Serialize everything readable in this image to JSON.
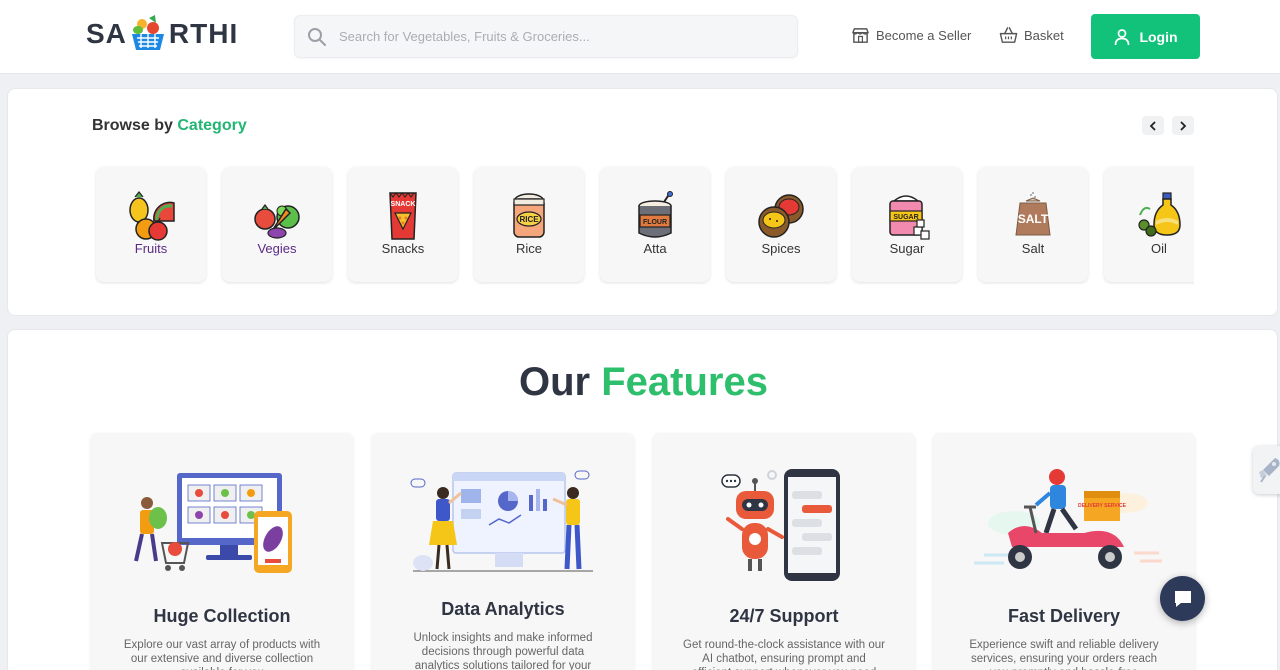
{
  "header": {
    "logo_left": "SA",
    "logo_right": "RTHI",
    "search_placeholder": "Search for Vegetables, Fruits & Groceries...",
    "become_seller": "Become a Seller",
    "basket": "Basket",
    "login": "Login",
    "accent_color": "#13c27a"
  },
  "categories": {
    "title_prefix": "Browse by",
    "title_accent": "Category",
    "items": [
      {
        "label": "Fruits",
        "icon": "fruits-icon"
      },
      {
        "label": "Vegies",
        "icon": "vegetables-icon"
      },
      {
        "label": "Snacks",
        "icon": "snacks-icon"
      },
      {
        "label": "Rice",
        "icon": "rice-icon"
      },
      {
        "label": "Atta",
        "icon": "flour-icon"
      },
      {
        "label": "Spices",
        "icon": "spices-icon"
      },
      {
        "label": "Sugar",
        "icon": "sugar-icon"
      },
      {
        "label": "Salt",
        "icon": "salt-icon"
      },
      {
        "label": "Oil",
        "icon": "oil-icon"
      }
    ],
    "tile_labels": {
      "snack_pack": "SNACK",
      "rice_jar": "RICE",
      "flour_jar": "FLOUR",
      "sugar_jar": "SUGAR",
      "salt_bag": "SALT"
    }
  },
  "features": {
    "heading_prefix": "Our",
    "heading_accent": "Features",
    "items": [
      {
        "title": "Huge Collection",
        "desc": "Explore our vast array of products with our extensive and diverse collection available for you"
      },
      {
        "title": "Data Analytics",
        "desc": "Unlock insights and make informed decisions through powerful data analytics solutions tailored for your"
      },
      {
        "title": "24/7 Support",
        "desc": "Get round-the-clock assistance with our AI chatbot, ensuring prompt and efficient support whenever you need"
      },
      {
        "title": "Fast Delivery",
        "desc": "Experience swift and reliable delivery services, ensuring your orders reach you promptly and hassle-free"
      }
    ],
    "delivery_box_text": "DELIVERY SERVICE"
  }
}
